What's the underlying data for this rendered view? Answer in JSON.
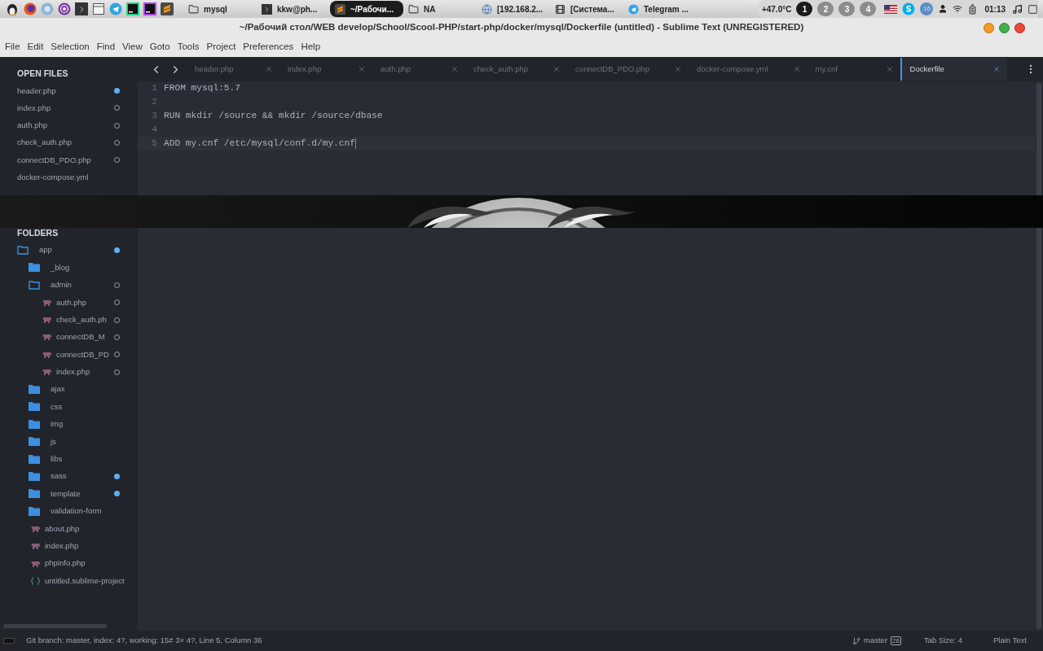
{
  "taskbar": {
    "launchers": [
      {
        "kind": "penguin"
      },
      {
        "kind": "firefox"
      },
      {
        "kind": "browser"
      },
      {
        "kind": "tor"
      },
      {
        "kind": "terminal"
      },
      {
        "kind": "files"
      },
      {
        "kind": "telegram"
      },
      {
        "kind": "pycharm"
      },
      {
        "kind": "phpstorm"
      },
      {
        "kind": "sublime"
      }
    ],
    "tasks": [
      {
        "label": "mysql",
        "kind": "folder",
        "selected": false
      },
      {
        "label": "kkw@ph...",
        "kind": "terminal",
        "selected": false
      },
      {
        "label": "~/Рабочи...",
        "kind": "sublime",
        "selected": true
      },
      {
        "label": "NA",
        "kind": "folder",
        "selected": false
      },
      {
        "label": "[192.168.2...",
        "kind": "browser",
        "selected": false
      },
      {
        "label": "[Система...",
        "kind": "video",
        "selected": false
      },
      {
        "label": "Telegram ...",
        "kind": "telegram",
        "selected": false
      }
    ],
    "temperature": "+47.0°C",
    "workspaces": [
      {
        "label": "1",
        "selected": true
      },
      {
        "label": "2",
        "selected": false
      },
      {
        "label": "3",
        "selected": false
      },
      {
        "label": "4",
        "selected": false
      }
    ],
    "notification_count": "16",
    "clock": "01:13"
  },
  "window": {
    "title": "~/Рабочий стол/WEB develop/School/Scool-PHP/start-php/docker/mysql/Dockerfile (untitled) - Sublime Text (UNREGISTERED)"
  },
  "menu": [
    "File",
    "Edit",
    "Selection",
    "Find",
    "View",
    "Goto",
    "Tools",
    "Project",
    "Preferences",
    "Help"
  ],
  "tabs": [
    {
      "label": "header.php",
      "selected": false
    },
    {
      "label": "index.php",
      "selected": false
    },
    {
      "label": "auth.php",
      "selected": false
    },
    {
      "label": "check_auth.php",
      "selected": false
    },
    {
      "label": "connectDB_PDO.php",
      "selected": false
    },
    {
      "label": "docker-compose.yml",
      "selected": false
    },
    {
      "label": "my.cnf",
      "selected": false
    },
    {
      "label": "Dockerfile",
      "selected": true
    }
  ],
  "sidebar": {
    "open_files_title": "OPEN FILES",
    "open_files": [
      {
        "name": "header.php",
        "tracked": true,
        "modified": true
      },
      {
        "name": "index.php",
        "tracked": true,
        "modified": false
      },
      {
        "name": "auth.php",
        "tracked": true,
        "modified": false
      },
      {
        "name": "check_auth.php",
        "tracked": true,
        "modified": false
      },
      {
        "name": "connectDB_PDO.php",
        "tracked": true,
        "modified": false
      },
      {
        "name": "docker-compose.yml",
        "tracked": false
      }
    ],
    "folders_title": "FOLDERS",
    "folders": [
      {
        "name": "app",
        "kind": "folder",
        "expanded": true,
        "tracked": true,
        "modified": true,
        "children": [
          {
            "name": "_blog",
            "kind": "folder",
            "expanded": false,
            "tracked": false
          },
          {
            "name": "admin",
            "kind": "folder",
            "expanded": true,
            "tracked": true,
            "modified": false,
            "children": [
              {
                "name": "auth.php",
                "kind": "file",
                "tracked": true,
                "modified": false
              },
              {
                "name": "check_auth.ph",
                "kind": "file",
                "tracked": true,
                "modified": false
              },
              {
                "name": "connectDB_M",
                "kind": "file",
                "tracked": true,
                "modified": false
              },
              {
                "name": "connectDB_PD",
                "kind": "file",
                "tracked": true,
                "modified": false
              },
              {
                "name": "index.php",
                "kind": "file",
                "tracked": true,
                "modified": false
              }
            ]
          },
          {
            "name": "ajax",
            "kind": "folder",
            "expanded": false,
            "tracked": false
          },
          {
            "name": "css",
            "kind": "folder",
            "expanded": false,
            "tracked": false
          },
          {
            "name": "img",
            "kind": "folder",
            "expanded": false,
            "tracked": false
          },
          {
            "name": "js",
            "kind": "folder",
            "expanded": false,
            "tracked": false
          },
          {
            "name": "libs",
            "kind": "folder",
            "expanded": false,
            "tracked": false
          },
          {
            "name": "sass",
            "kind": "folder",
            "expanded": false,
            "tracked": true,
            "modified": true
          },
          {
            "name": "template",
            "kind": "folder",
            "expanded": false,
            "tracked": true,
            "modified": true
          },
          {
            "name": "validation-form",
            "kind": "folder",
            "expanded": false,
            "tracked": false
          },
          {
            "name": "about.php",
            "kind": "file",
            "tracked": false
          },
          {
            "name": "index.php",
            "kind": "file",
            "tracked": false
          },
          {
            "name": "phpinfo.php",
            "kind": "file",
            "tracked": false
          },
          {
            "name": "untitled.sublime-project",
            "kind": "project",
            "tracked": false
          }
        ]
      }
    ]
  },
  "editor": {
    "lines": [
      {
        "number": "1",
        "text": "FROM mysql:5.7",
        "selected": false
      },
      {
        "number": "2",
        "selected": false
      },
      {
        "number": "3",
        "text": "RUN mkdir /source && mkdir /source/dbase",
        "selected": false
      },
      {
        "number": "4",
        "selected": false
      },
      {
        "number": "5",
        "text": "ADD my.cnf /etc/mysql/conf.d/my.cnf",
        "selected": true
      }
    ]
  },
  "status_bar": {
    "git": "Git branch: master, index: 4?, working: 15≠ 3× 4?, Line 5, Column 36",
    "branch": "master",
    "branch_badge": "26",
    "tab_size": "Tab Size: 4",
    "syntax": "Plain Text"
  }
}
